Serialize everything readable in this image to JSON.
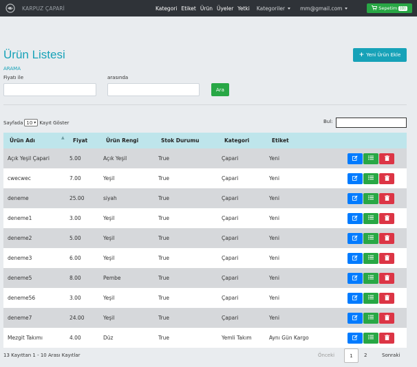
{
  "navbar": {
    "brand": "KARPUZ ÇAPARİ",
    "links": [
      "Kategori",
      "Etiket",
      "Ürün",
      "Üyeler",
      "Yetki"
    ],
    "categories_dropdown": "Kategoriler",
    "user_dropdown": "mm@gmail.com",
    "cart_label": "Sepetim",
    "cart_count": "(0)"
  },
  "page": {
    "title": "Ürün Listesi",
    "add_button": "Yeni Ürün Ekle"
  },
  "search": {
    "heading": "ARAMA",
    "price_label": "Fiyatı ile",
    "between_label": "arasında",
    "min_value": "",
    "max_value": "",
    "button": "Ara"
  },
  "table_controls": {
    "show_prefix": "Sayfada",
    "page_size": "10",
    "show_suffix": "Kayıt Göster",
    "find_label": "Bul:",
    "find_value": ""
  },
  "table": {
    "columns": [
      "Ürün Adı",
      "Fiyat",
      "Ürün Rengi",
      "Stok Durumu",
      "Kategori",
      "Etiket"
    ],
    "rows": [
      [
        "Açık Yeşil Çapari",
        "5.00",
        "Açık Yeşil",
        "True",
        "Çapari",
        "Yeni"
      ],
      [
        "cwecwec",
        "7.00",
        "Yeşil",
        "True",
        "Çapari",
        "Yeni"
      ],
      [
        "deneme",
        "25.00",
        "siyah",
        "True",
        "Çapari",
        "Yeni"
      ],
      [
        "deneme1",
        "3.00",
        "Yeşil",
        "True",
        "Çapari",
        "Yeni"
      ],
      [
        "deneme2",
        "5.00",
        "Yeşil",
        "True",
        "Çapari",
        "Yeni"
      ],
      [
        "deneme3",
        "6.00",
        "Yeşil",
        "True",
        "Çapari",
        "Yeni"
      ],
      [
        "deneme5",
        "8.00",
        "Pembe",
        "True",
        "Çapari",
        "Yeni"
      ],
      [
        "deneme56",
        "3.00",
        "Yeşil",
        "True",
        "Çapari",
        "Yeni"
      ],
      [
        "deneme7",
        "24.00",
        "Yeşil",
        "True",
        "Çapari",
        "Yeni"
      ],
      [
        "Mezgit Takımı",
        "4.00",
        "Düz",
        "True",
        "Yemli Takım",
        "Aynı Gün Kargo"
      ]
    ]
  },
  "footer": {
    "info": "13 Kayıttan 1 - 10 Arası Kayıtlar",
    "prev": "Önceki",
    "pages": [
      "1",
      "2"
    ],
    "next": "Sonraki"
  },
  "colors": {
    "accent": "#17a2b8",
    "success": "#28a745",
    "primary": "#007bff",
    "danger": "#dc3545",
    "navbar": "#2f3338",
    "table_header": "#bee5eb"
  }
}
